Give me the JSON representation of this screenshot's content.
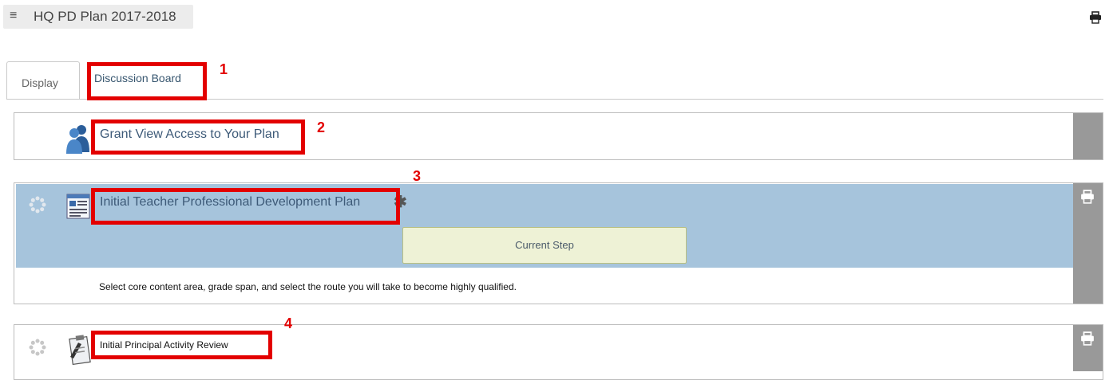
{
  "header": {
    "title": "HQ PD Plan 2017-2018",
    "menu_icon": "hamburger-icon",
    "print_icon": "print-icon"
  },
  "tabs": [
    {
      "label": "Display",
      "active": true
    },
    {
      "label": "Discussion Board",
      "active": false
    }
  ],
  "annotations": [
    "1",
    "2",
    "3",
    "4"
  ],
  "grant_panel": {
    "link": "Grant View Access to Your Plan",
    "icon": "users-icon"
  },
  "initial_plan_panel": {
    "title": "Initial Teacher Professional Development Plan",
    "required_mark": "✱",
    "status_button": "Current Step",
    "description": "Select core content area, grade span, and select the route you will take to become highly qualified.",
    "icon": "document-icon"
  },
  "principal_panel": {
    "title": "Initial Principal Activity Review",
    "icon": "clipboard-icon"
  },
  "colors": {
    "annotation_red": "#e30000",
    "active_band": "#a6c4dc",
    "side_bar": "#999999",
    "link": "#3d5a78"
  }
}
